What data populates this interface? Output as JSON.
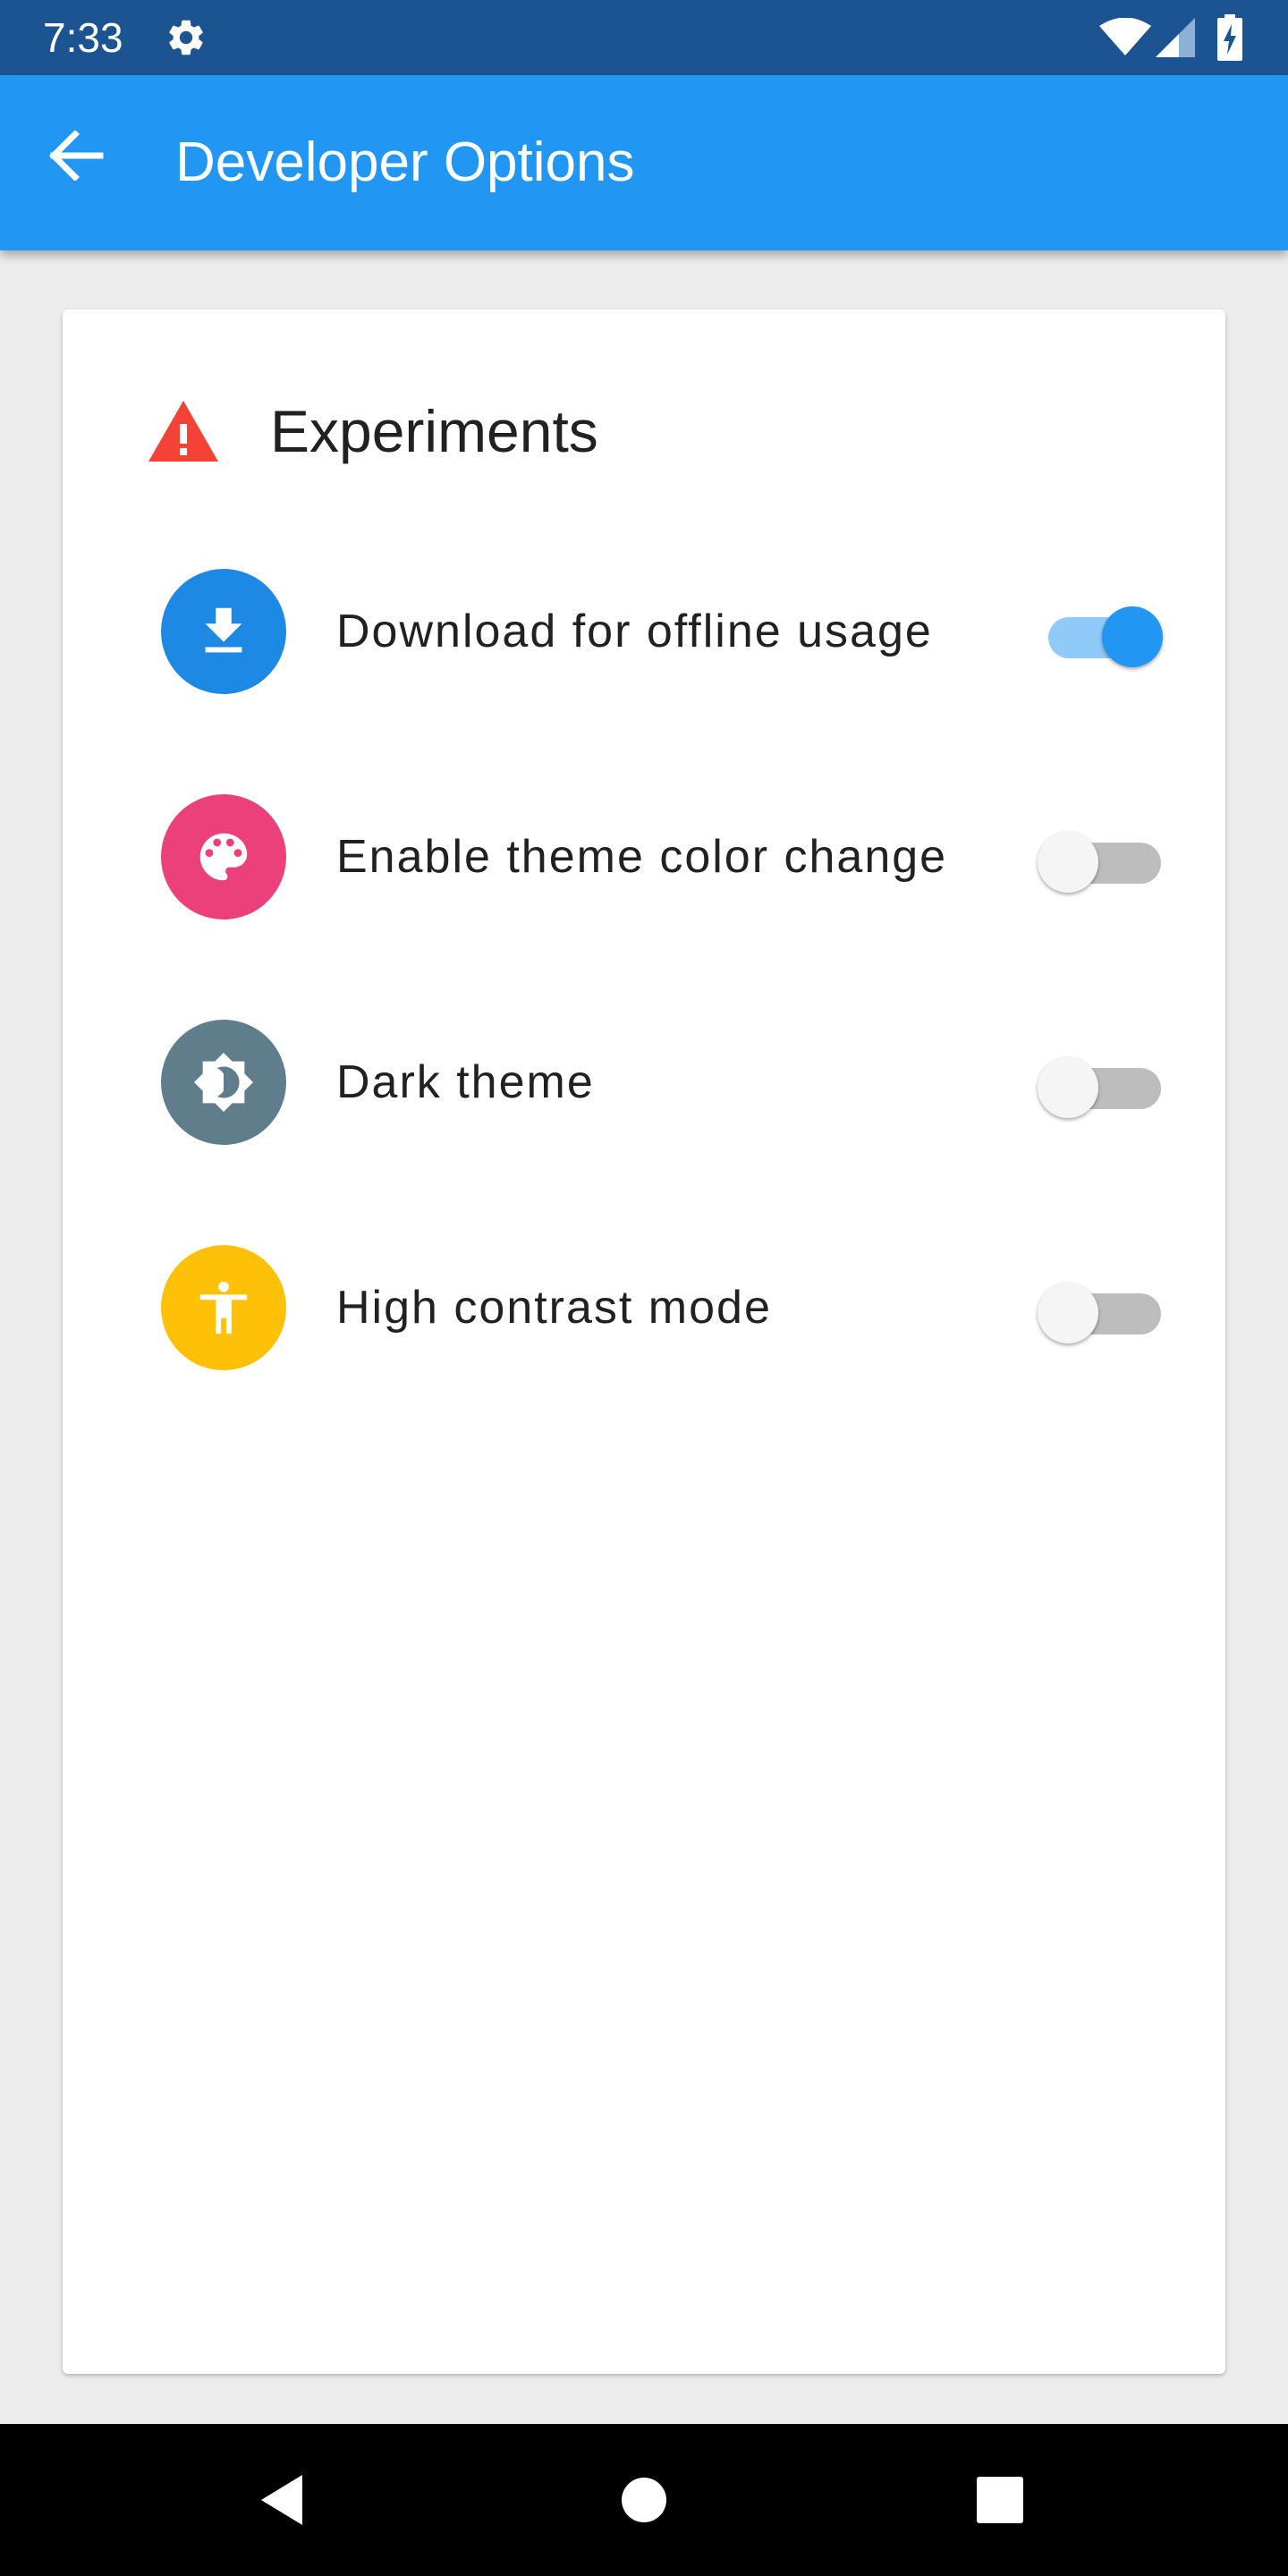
{
  "status_bar": {
    "time": "7:33",
    "icons": [
      "gear-icon",
      "wifi-icon",
      "cellular-signal-icon",
      "battery-charging-icon"
    ]
  },
  "app_bar": {
    "title": "Developer Options",
    "back_icon": "arrow-left-icon",
    "color": "#2196f3"
  },
  "card": {
    "section": {
      "title": "Experiments",
      "icon": "warning-icon",
      "icon_color": "#f44336"
    },
    "settings": [
      {
        "label": "Download for offline usage",
        "icon": "download-icon",
        "icon_color": "#1e88e5",
        "enabled": true
      },
      {
        "label": "Enable theme color change",
        "icon": "palette-icon",
        "icon_color": "#ec407a",
        "enabled": false
      },
      {
        "label": "Dark theme",
        "icon": "brightness-contrast-icon",
        "icon_color": "#607d8b",
        "enabled": false
      },
      {
        "label": "High contrast mode",
        "icon": "accessibility-icon",
        "icon_color": "#ffc107",
        "enabled": false
      }
    ]
  },
  "nav_bar": {
    "buttons": [
      "back-triangle-icon",
      "home-circle-icon",
      "recents-square-icon"
    ]
  },
  "colors": {
    "status_bar": "#1c5491",
    "background": "#ececec",
    "switch_on_thumb": "#2196f3",
    "switch_on_track": "#90caf9",
    "switch_off_thumb": "#f5f5f5",
    "switch_off_track": "#bdbdbd"
  }
}
